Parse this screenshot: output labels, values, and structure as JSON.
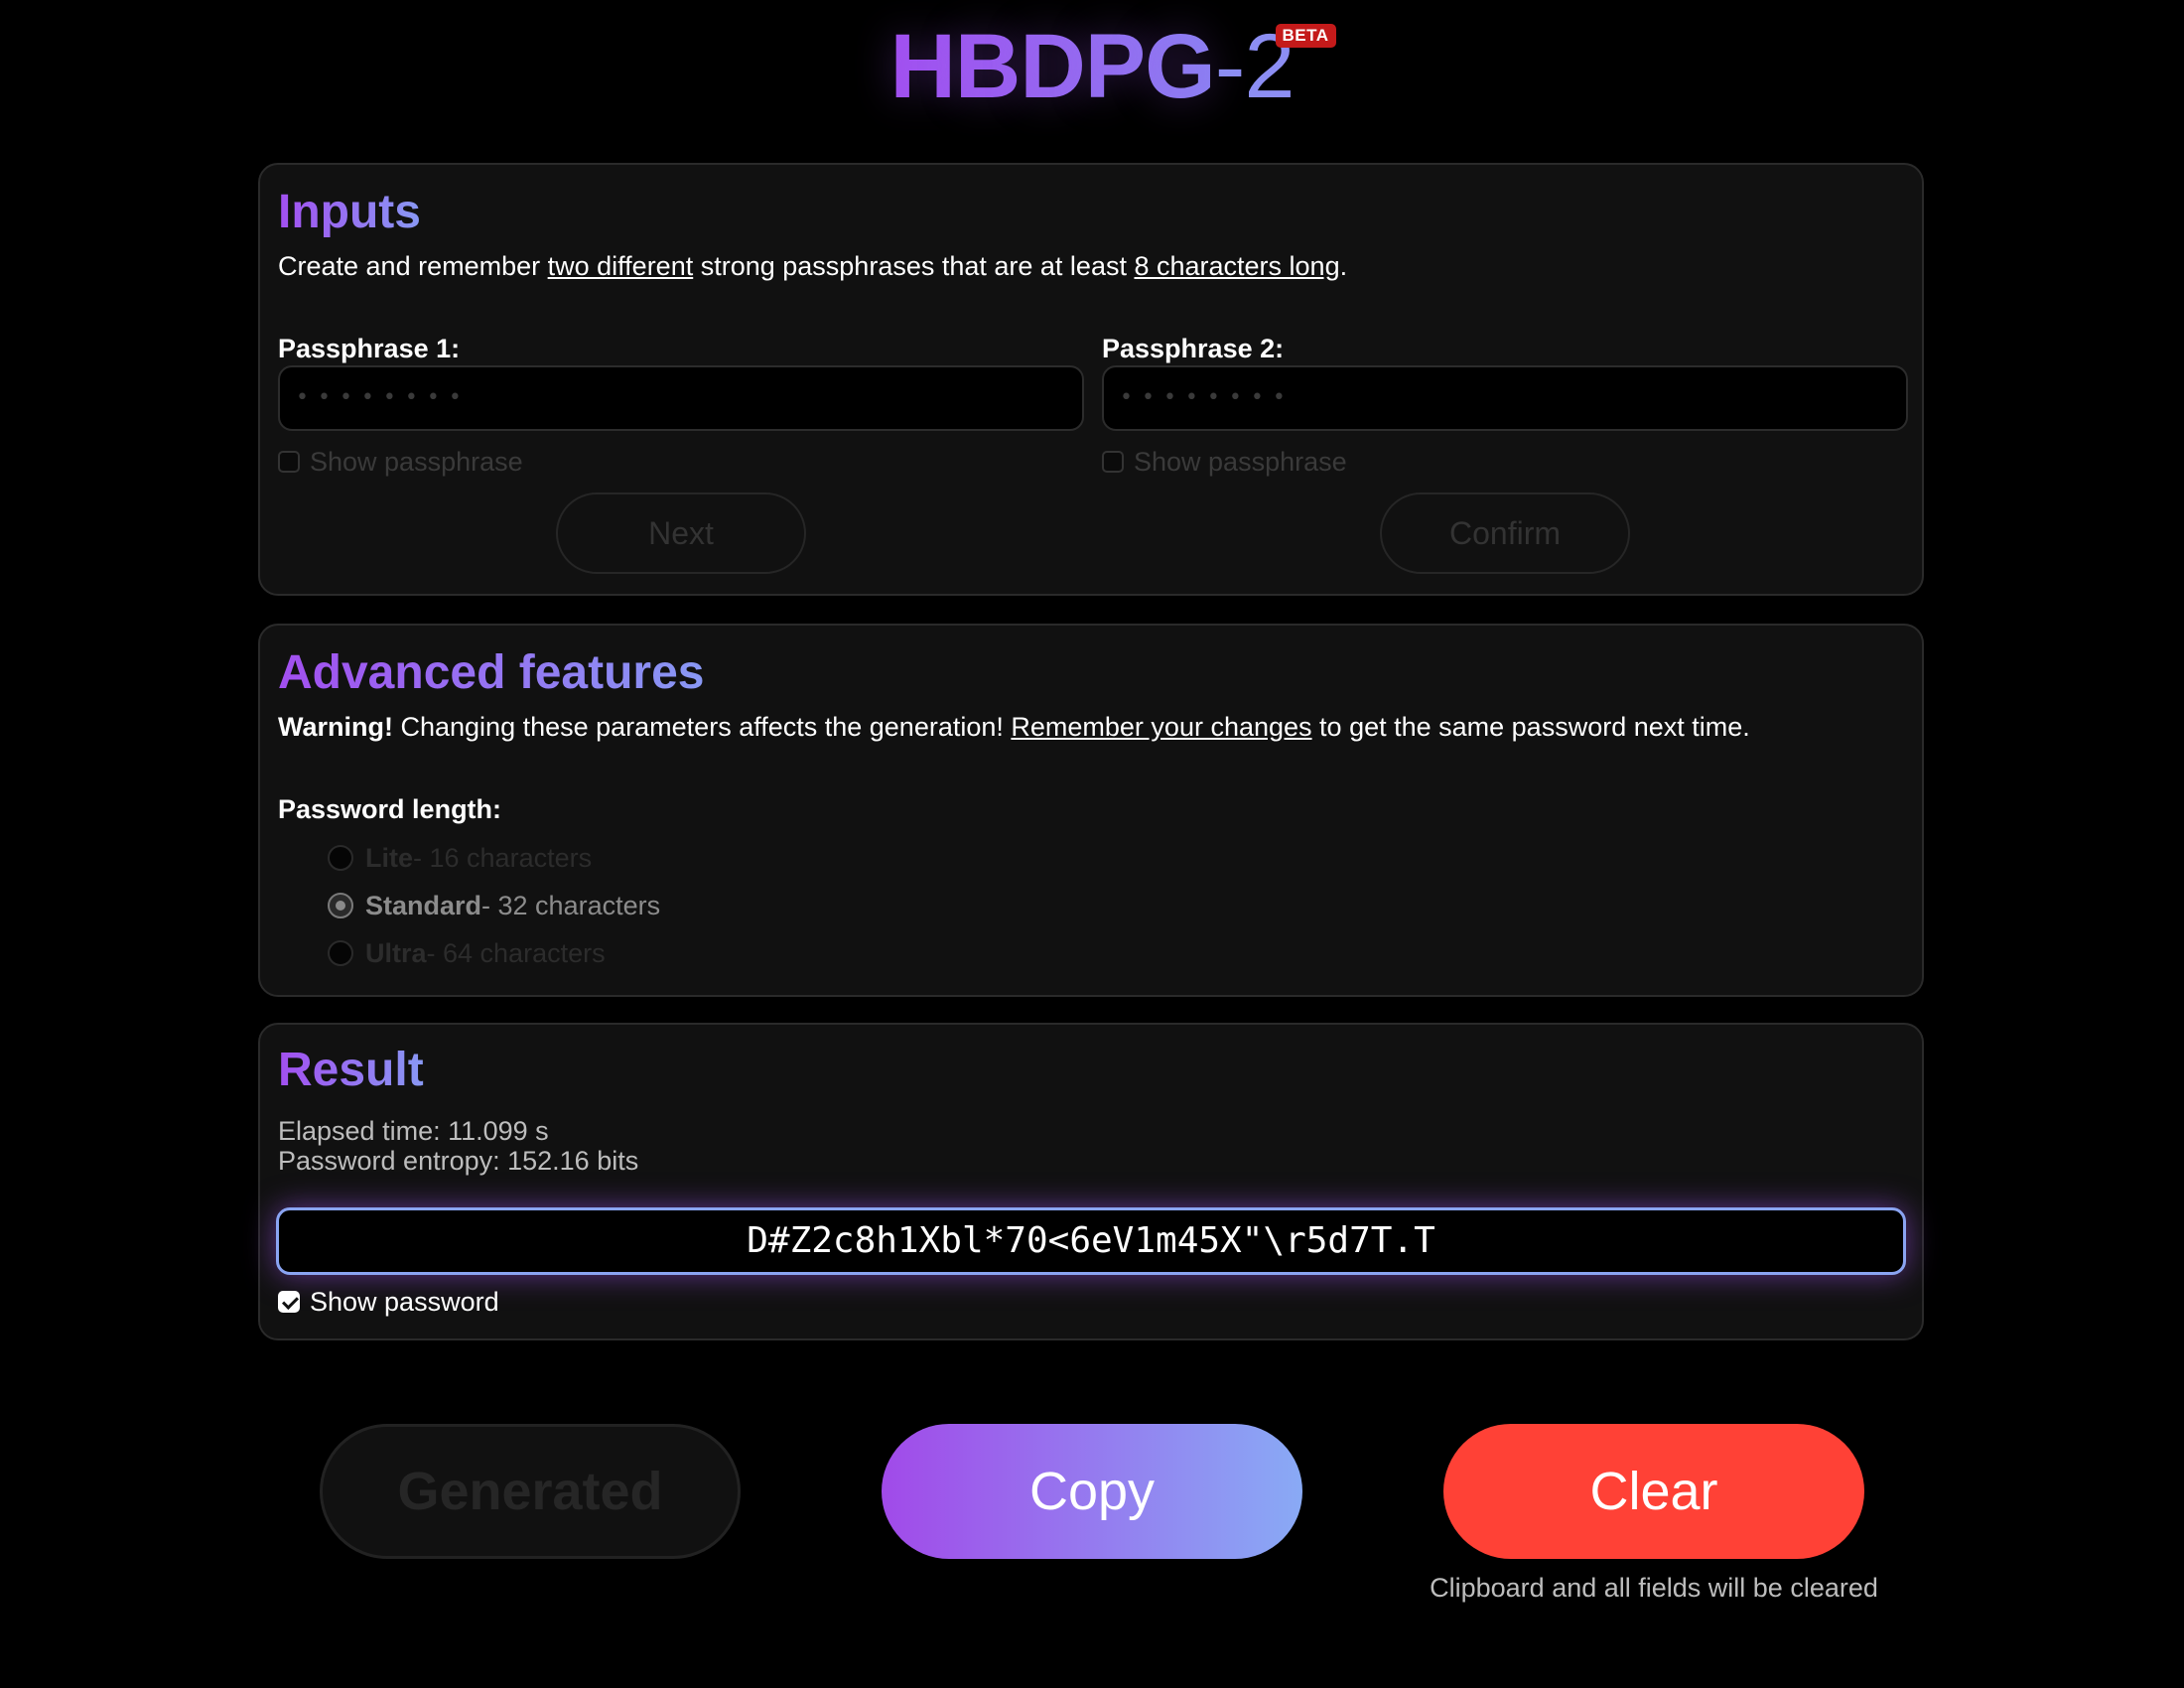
{
  "logo": {
    "main": "HBDPG",
    "dash": "-",
    "version": "2",
    "badge": "BETA"
  },
  "inputs": {
    "title": "Inputs",
    "desc_pre": "Create and remember ",
    "desc_link1": "two different",
    "desc_mid": " strong passphrases that are at least ",
    "desc_link2": "8 characters long",
    "desc_post": ".",
    "passphrase1": {
      "label": "Passphrase 1:",
      "placeholder": "••••••••",
      "show_label": "Show passphrase",
      "button": "Next"
    },
    "passphrase2": {
      "label": "Passphrase 2:",
      "placeholder": "••••••••",
      "show_label": "Show passphrase",
      "button": "Confirm"
    }
  },
  "advanced": {
    "title": "Advanced features",
    "warning_bold": "Warning!",
    "warning_text": " Changing these parameters affects the generation! ",
    "warning_link": "Remember your changes",
    "warning_post": " to get the same password next time.",
    "length_label": "Password length:",
    "options": [
      {
        "name": "Lite",
        "desc": " - 16 characters",
        "selected": false
      },
      {
        "name": "Standard",
        "desc": " - 32 characters",
        "selected": true
      },
      {
        "name": "Ultra",
        "desc": " - 64 characters",
        "selected": false
      }
    ]
  },
  "result": {
    "title": "Result",
    "elapsed": "Elapsed time: 11.099 s",
    "entropy": "Password entropy: 152.16 bits",
    "password": "D#Z2c8h1Xbl*70<6eV1m45X\"\\r5d7T.T",
    "show_label": "Show password",
    "show_checked": true
  },
  "actions": {
    "generated": "Generated",
    "copy": "Copy",
    "clear": "Clear",
    "clear_note": "Clipboard and all fields will be cleared"
  },
  "colors": {
    "accent_start": "#a24ff0",
    "accent_end": "#89aaf5",
    "clear": "#ff4136",
    "beta": "#c41a1a"
  }
}
